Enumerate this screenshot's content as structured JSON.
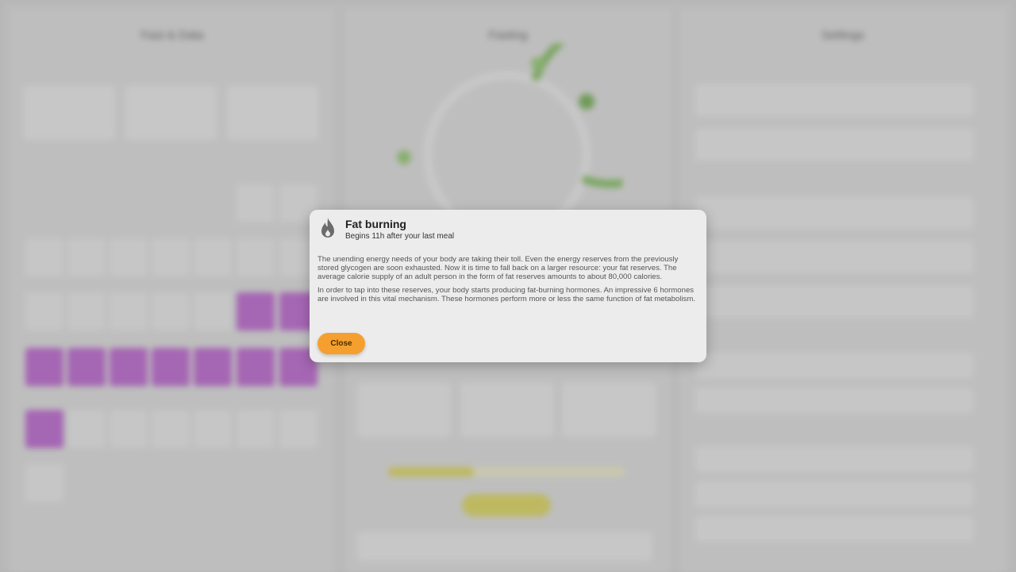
{
  "background": {
    "panels": [
      {
        "title": "Fast & Data"
      },
      {
        "title": "Fasting"
      },
      {
        "title": "Settings"
      }
    ],
    "colors": {
      "accent_green": "#7cb65a",
      "purple": "#b560c8",
      "yellow": "#d6cf5a",
      "orange": "#f5a02e"
    }
  },
  "modal": {
    "icon": "flame-icon",
    "title": "Fat burning",
    "subtitle": "Begins 11h after your last meal",
    "paragraphs": [
      "The unending energy needs of your body are taking their toll. Even the energy reserves from the previously stored glycogen are soon exhausted. Now it is time to fall back on a larger resource: your fat reserves. The average calorie supply of an adult person in the form of fat reserves amounts to about 80,000 calories.",
      "In order to tap into these reserves, your body starts producing fat-burning hormones. An impressive 6 hormones are involved in this vital mechanism. These hormones perform more or less the same function of fat metabolism."
    ],
    "close_label": "Close"
  }
}
